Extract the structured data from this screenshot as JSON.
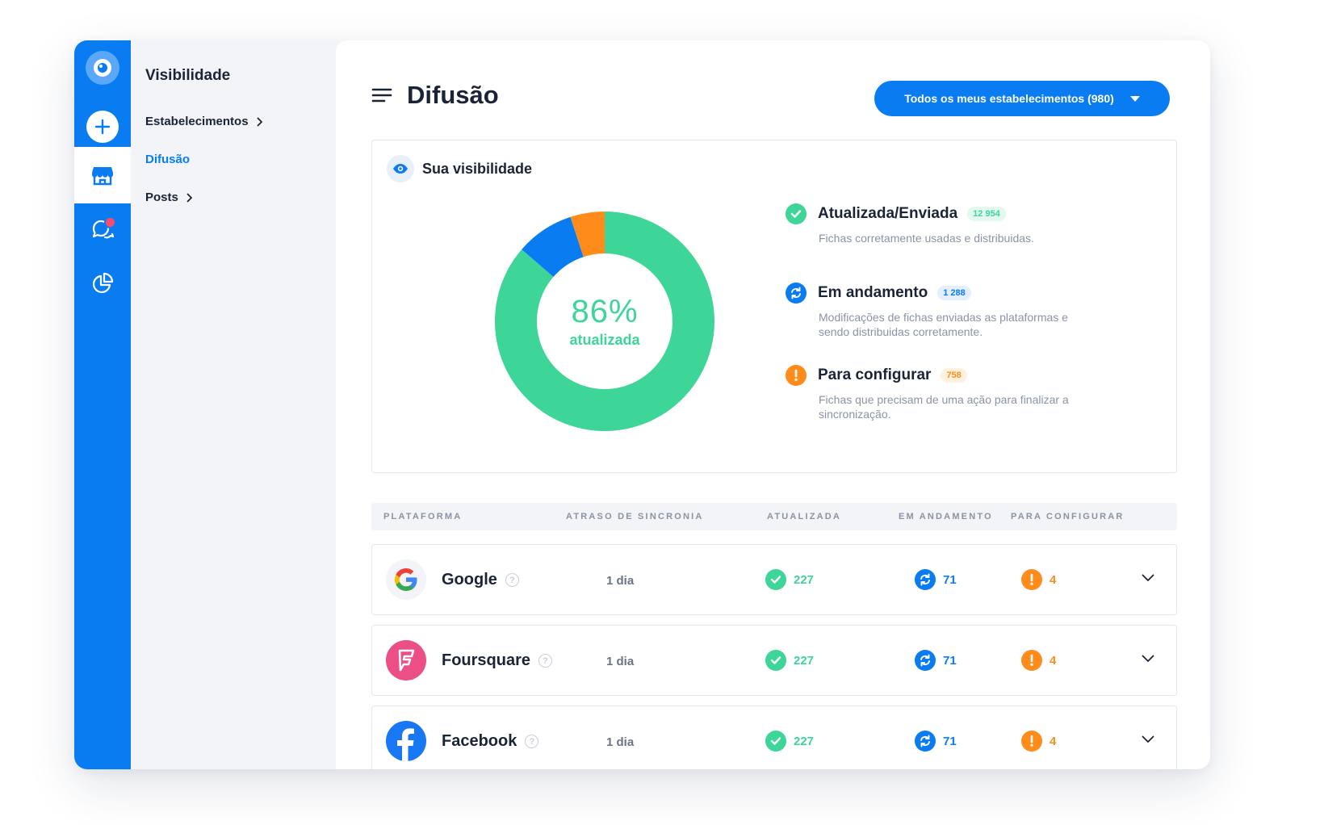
{
  "colors": {
    "primary": "#0a7cf2",
    "updated": "#3dd598",
    "in_progress": "#0a7cf2",
    "to_configure": "#ff8c1a",
    "notification": "#ff4b6b"
  },
  "rail": {
    "items": [
      {
        "icon": "eye-logo-icon"
      },
      {
        "icon": "plus-icon"
      },
      {
        "icon": "store-icon",
        "active": true
      },
      {
        "icon": "chat-bubbles-icon",
        "has_notification": true
      },
      {
        "icon": "pie-chart-icon"
      }
    ]
  },
  "subnav": {
    "title": "Visibilidade",
    "items": [
      {
        "label": "Estabelecimentos",
        "has_chevron": true
      },
      {
        "label": "Difusão",
        "active": true
      },
      {
        "label": "Posts",
        "has_chevron": true
      }
    ]
  },
  "header": {
    "title": "Difusão",
    "scope_button": "Todos os meus estabelecimentos (980)"
  },
  "visibility": {
    "title": "Sua visibilidade",
    "percent_label": "86%",
    "center_caption": "atualizada",
    "chart_data": {
      "type": "pie",
      "donut": true,
      "slices": [
        {
          "name": "Atualizada/Enviada",
          "value": 12954,
          "color": "#3dd598"
        },
        {
          "name": "Em andamento",
          "value": 1288,
          "color": "#0a7cf2"
        },
        {
          "name": "Para configurar",
          "value": 758,
          "color": "#ff8c1a"
        }
      ]
    },
    "legend": [
      {
        "name": "Atualizada/Enviada",
        "count": "12 954",
        "description": "Fichas corretamente usadas e distribuidas."
      },
      {
        "name": "Em andamento",
        "count": "1 288",
        "description": "Modificações de fichas enviadas as plataformas e sendo distribuidas corretamente."
      },
      {
        "name": "Para configurar",
        "count": "758",
        "description": "Fichas que precisam de uma ação para finalizar a sincronização."
      }
    ]
  },
  "table": {
    "columns": [
      "PLATAFORMA",
      "ATRASO DE SINCRONIA",
      "ATUALIZADA",
      "EM ANDAMENTO",
      "PARA CONFIGURAR"
    ],
    "rows": [
      {
        "platform": "Google",
        "delay": "1 dia",
        "updated": "227",
        "in_progress": "71",
        "to_configure": "4"
      },
      {
        "platform": "Foursquare",
        "delay": "1 dia",
        "updated": "227",
        "in_progress": "71",
        "to_configure": "4"
      },
      {
        "platform": "Facebook",
        "delay": "1 dia",
        "updated": "227",
        "in_progress": "71",
        "to_configure": "4"
      }
    ]
  }
}
